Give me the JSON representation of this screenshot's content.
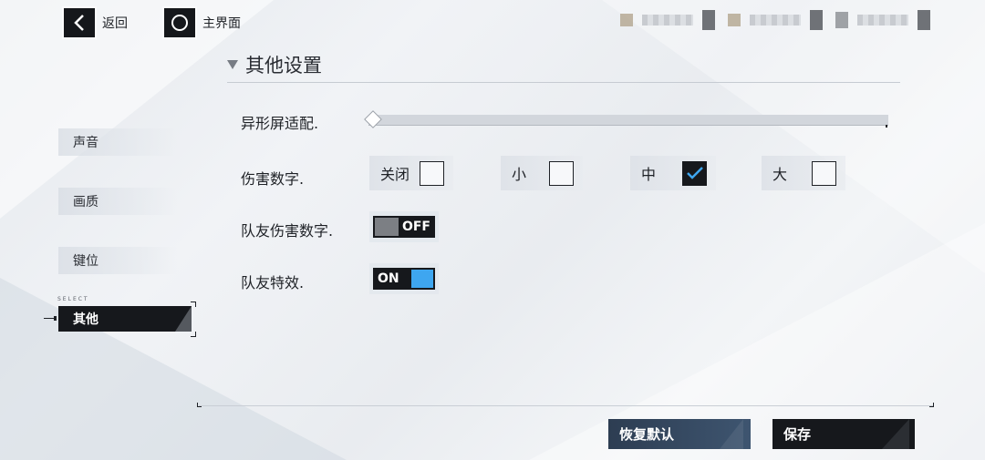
{
  "colors": {
    "accent_dark": "#16181c",
    "toggle_on": "#3ea6f0",
    "toggle_off": "#7c7f84",
    "reset_button": "#3e5570"
  },
  "topbar": {
    "back_label": "返回",
    "back_icon": "chevron-left-icon",
    "home_label": "主界面",
    "home_icon": "circle-icon"
  },
  "section": {
    "title": "其他设置"
  },
  "sidebar": {
    "select_tag": "SELECT",
    "items": [
      {
        "label": "声音"
      },
      {
        "label": "画质"
      },
      {
        "label": "键位"
      },
      {
        "label": "其他",
        "active": true
      }
    ]
  },
  "settings": {
    "notch_adapt": {
      "label": "异形屏适配.",
      "value": 0
    },
    "damage_numbers": {
      "label": "伤害数字.",
      "options": [
        {
          "label": "关闭",
          "checked": false
        },
        {
          "label": "小",
          "checked": false
        },
        {
          "label": "中",
          "checked": true
        },
        {
          "label": "大",
          "checked": false
        }
      ]
    },
    "teammate_damage_numbers": {
      "label": "队友伤害数字.",
      "state": "OFF"
    },
    "teammate_effects": {
      "label": "队友特效.",
      "state": "ON"
    }
  },
  "actions": {
    "reset_label": "恢复默认",
    "save_label": "保存"
  }
}
